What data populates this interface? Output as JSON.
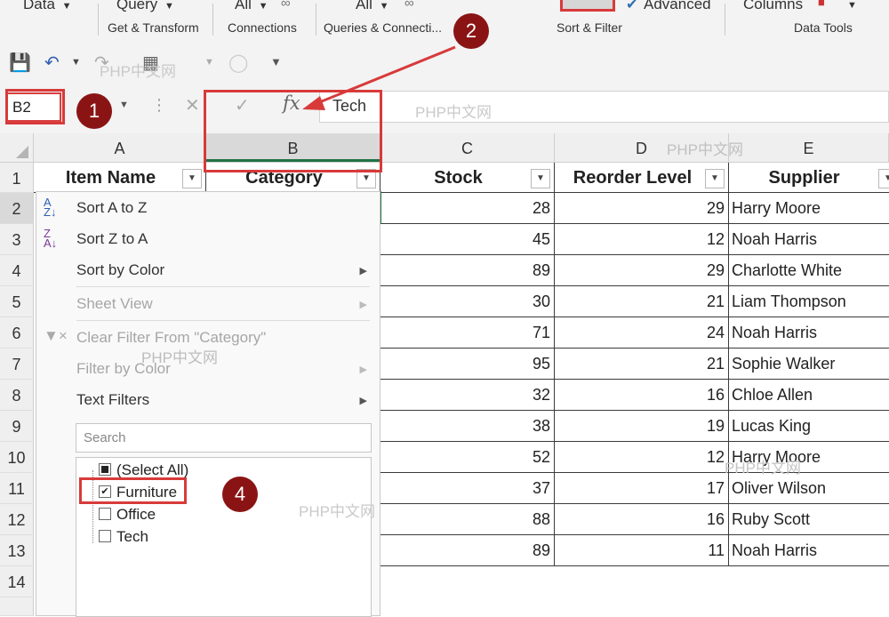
{
  "ribbon": {
    "data_btn": "Data",
    "query_btn": "Query",
    "all1_btn": "All",
    "all2_btn": "All",
    "advanced_btn": "Advanced",
    "columns_btn": "Columns",
    "groups": [
      "Get & Transform",
      "Connections",
      "Queries & Connecti...",
      "Sort & Filter",
      "Data Tools"
    ]
  },
  "name_box": "B2",
  "formula": "Tech",
  "watermark": "PHP中文网",
  "columns": [
    "A",
    "B",
    "C",
    "D",
    "E"
  ],
  "rows": [
    "1",
    "2",
    "3",
    "4",
    "5",
    "6",
    "7",
    "8",
    "9",
    "10",
    "11",
    "12",
    "13",
    "14"
  ],
  "headers": [
    "Item Name",
    "Category",
    "Stock",
    "Reorder Level",
    "Supplier"
  ],
  "stock": [
    "28",
    "45",
    "89",
    "30",
    "71",
    "95",
    "32",
    "38",
    "52",
    "37",
    "88",
    "89"
  ],
  "reorder": [
    "29",
    "12",
    "29",
    "21",
    "24",
    "21",
    "16",
    "19",
    "12",
    "17",
    "16",
    "11"
  ],
  "supplier": [
    "Harry Moore",
    "Noah Harris",
    "Charlotte White",
    "Liam Thompson",
    "Noah Harris",
    "Sophie Walker",
    "Chloe Allen",
    "Lucas King",
    "Harry Moore",
    "Oliver Wilson",
    "Ruby Scott",
    "Noah Harris"
  ],
  "menu": {
    "sort_az": "Sort A to Z",
    "sort_za": "Sort Z to A",
    "sort_color": "Sort by Color",
    "sheet_view": "Sheet View",
    "clear_filter": "Clear Filter From \"Category\"",
    "filter_color": "Filter by Color",
    "text_filters": "Text Filters",
    "search_placeholder": "Search",
    "options": [
      "(Select All)",
      "Furniture",
      "Office",
      "Tech"
    ]
  },
  "badges": [
    "1",
    "2",
    "4"
  ]
}
